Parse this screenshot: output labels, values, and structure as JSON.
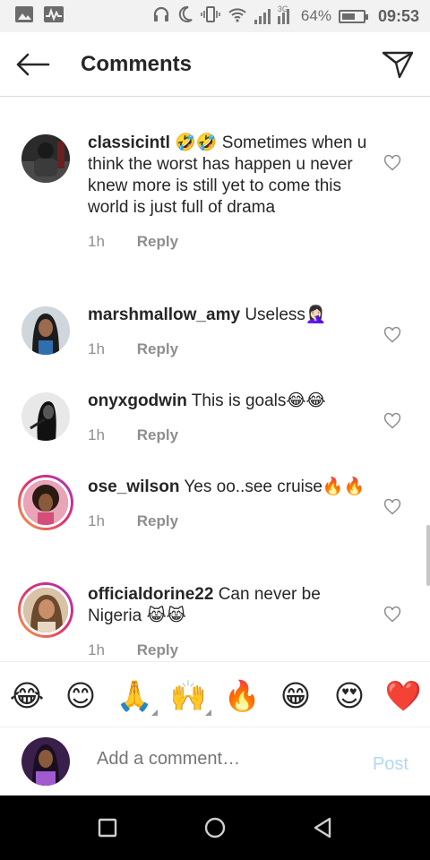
{
  "status_bar": {
    "battery_percent": "64%",
    "time": "09:53",
    "network_label": "3G",
    "battery_level": 0.64
  },
  "header": {
    "title": "Comments"
  },
  "comments": [
    {
      "username": "classicintl",
      "text": "🤣🤣 Sometimes when u think the worst has happen u never knew more is still yet to come this world is just full of drama",
      "time": "1h",
      "reply": "Reply",
      "story_ring": false
    },
    {
      "username": "marshmallow_amy",
      "text": "Useless🤦🏻‍♀️",
      "time": "1h",
      "reply": "Reply",
      "story_ring": false
    },
    {
      "username": "onyxgodwin",
      "text": "This is goals😂😂",
      "time": "1h",
      "reply": "Reply",
      "story_ring": false
    },
    {
      "username": "ose_wilson",
      "text": "Yes oo..see cruise🔥🔥",
      "time": "1h",
      "reply": "Reply",
      "story_ring": true
    },
    {
      "username": "officialdorine22",
      "text": "Can never be Nigeria 😹😹",
      "time": "1h",
      "reply": "Reply",
      "story_ring": true
    }
  ],
  "emoji_bar": [
    "😂",
    "😊",
    "🙏",
    "🙌",
    "🔥",
    "😁",
    "😍",
    "❤️"
  ],
  "composer": {
    "placeholder": "Add a comment…",
    "post_label": "Post"
  },
  "colors": {
    "post_disabled": "#b3d7f5",
    "ring_gradient": [
      "#f9a03f",
      "#e1306c",
      "#a234c2"
    ]
  }
}
